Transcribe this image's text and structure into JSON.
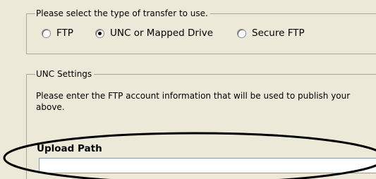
{
  "transfer_group": {
    "legend": "Please select the type of transfer to use.",
    "options": [
      {
        "label": "FTP",
        "checked": false
      },
      {
        "label": "UNC or Mapped Drive",
        "checked": true
      },
      {
        "label": "Secure  FTP",
        "checked": false
      }
    ]
  },
  "unc_group": {
    "legend": "UNC Settings",
    "description": "Please enter the FTP account information that will be used to publish your above.",
    "upload_path_label": "Upload Path",
    "upload_path_value": ""
  },
  "annotation": {
    "shape": "ellipse",
    "color": "#000000"
  }
}
